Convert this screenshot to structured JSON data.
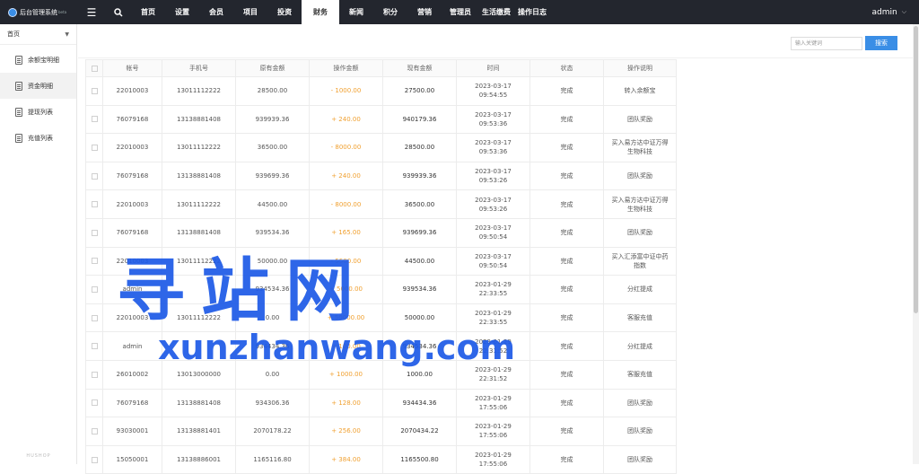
{
  "brand": {
    "title": "后台管理系统",
    "version": "beta"
  },
  "nav": {
    "menu_icon": "hamburger-icon",
    "search_icon": "search-icon",
    "items": [
      "首页",
      "设置",
      "会员",
      "项目",
      "投资",
      "财务",
      "新闻",
      "积分",
      "营销",
      "管理员",
      "生活缴费",
      "操作日志"
    ],
    "active": "财务"
  },
  "user": {
    "name": "admin"
  },
  "sidebar": {
    "header": "首页",
    "items": [
      {
        "label": "余额宝明细",
        "icon": "document-icon"
      },
      {
        "label": "资金明细",
        "icon": "document-icon",
        "active": true
      },
      {
        "label": "提现列表",
        "icon": "document-icon"
      },
      {
        "label": "充值列表",
        "icon": "document-icon"
      }
    ],
    "footer": "HUSHOP"
  },
  "search": {
    "placeholder": "输入关键词",
    "button": "搜索"
  },
  "table": {
    "headers": [
      "帐号",
      "手机号",
      "原有金额",
      "操作金额",
      "现有金额",
      "时间",
      "状态",
      "操作说明"
    ],
    "rows": [
      {
        "account": "22010003",
        "phone": "13011112222",
        "orig": "28500.00",
        "op": "- 1000.00",
        "cur": "27500.00",
        "date": "2023-03-17",
        "time": "09:54:55",
        "status": "完成",
        "note": "转入余额宝",
        "note2": ""
      },
      {
        "account": "76079168",
        "phone": "13138881408",
        "orig": "939939.36",
        "op": "+ 240.00",
        "cur": "940179.36",
        "date": "2023-03-17",
        "time": "09:53:36",
        "status": "完成",
        "note": "团队奖励",
        "note2": ""
      },
      {
        "account": "22010003",
        "phone": "13011112222",
        "orig": "36500.00",
        "op": "- 8000.00",
        "cur": "28500.00",
        "date": "2023-03-17",
        "time": "09:53:36",
        "status": "完成",
        "note": "买入易方达中证万得",
        "note2": "生物科技"
      },
      {
        "account": "76079168",
        "phone": "13138881408",
        "orig": "939699.36",
        "op": "+ 240.00",
        "cur": "939939.36",
        "date": "2023-03-17",
        "time": "09:53:26",
        "status": "完成",
        "note": "团队奖励",
        "note2": ""
      },
      {
        "account": "22010003",
        "phone": "13011112222",
        "orig": "44500.00",
        "op": "- 8000.00",
        "cur": "36500.00",
        "date": "2023-03-17",
        "time": "09:53:26",
        "status": "完成",
        "note": "买入易方达中证万得",
        "note2": "生物科技"
      },
      {
        "account": "76079168",
        "phone": "13138881408",
        "orig": "939534.36",
        "op": "+ 165.00",
        "cur": "939699.36",
        "date": "2023-03-17",
        "time": "09:50:54",
        "status": "完成",
        "note": "团队奖励",
        "note2": ""
      },
      {
        "account": "22010003",
        "phone": "13011112222",
        "orig": "50000.00",
        "op": "- 5500.00",
        "cur": "44500.00",
        "date": "2023-03-17",
        "time": "09:50:54",
        "status": "完成",
        "note": "买入汇添富中证中药",
        "note2": "指数"
      },
      {
        "account": "admin",
        "phone": "",
        "orig": "934534.36",
        "op": "+ 5000.00",
        "cur": "939534.36",
        "date": "2023-01-29",
        "time": "22:33:55",
        "status": "完成",
        "note": "分红提成",
        "note2": ""
      },
      {
        "account": "22010003",
        "phone": "13011112222",
        "orig": "0.00",
        "op": "+ 50000.00",
        "cur": "50000.00",
        "date": "2023-01-29",
        "time": "22:33:55",
        "status": "完成",
        "note": "客服充值",
        "note2": ""
      },
      {
        "account": "admin",
        "phone": "",
        "orig": "934434.36",
        "op": "+ 100.00",
        "cur": "934534.36",
        "date": "2023-01-29",
        "time": "22:31:52",
        "status": "完成",
        "note": "分红提成",
        "note2": ""
      },
      {
        "account": "26010002",
        "phone": "13013000000",
        "orig": "0.00",
        "op": "+ 1000.00",
        "cur": "1000.00",
        "date": "2023-01-29",
        "time": "22:31:52",
        "status": "完成",
        "note": "客服充值",
        "note2": ""
      },
      {
        "account": "76079168",
        "phone": "13138881408",
        "orig": "934306.36",
        "op": "+ 128.00",
        "cur": "934434.36",
        "date": "2023-01-29",
        "time": "17:55:06",
        "status": "完成",
        "note": "团队奖励",
        "note2": ""
      },
      {
        "account": "93030001",
        "phone": "13138881401",
        "orig": "2070178.22",
        "op": "+ 256.00",
        "cur": "2070434.22",
        "date": "2023-01-29",
        "time": "17:55:06",
        "status": "完成",
        "note": "团队奖励",
        "note2": ""
      },
      {
        "account": "15050001",
        "phone": "13138886001",
        "orig": "1165116.80",
        "op": "+ 384.00",
        "cur": "1165500.80",
        "date": "2023-01-29",
        "time": "17:55:06",
        "status": "完成",
        "note": "团队奖励",
        "note2": ""
      }
    ]
  },
  "watermark": {
    "cn": "寻站网",
    "en": "xunzhanwang.com",
    "color": "#1e5ae6"
  }
}
